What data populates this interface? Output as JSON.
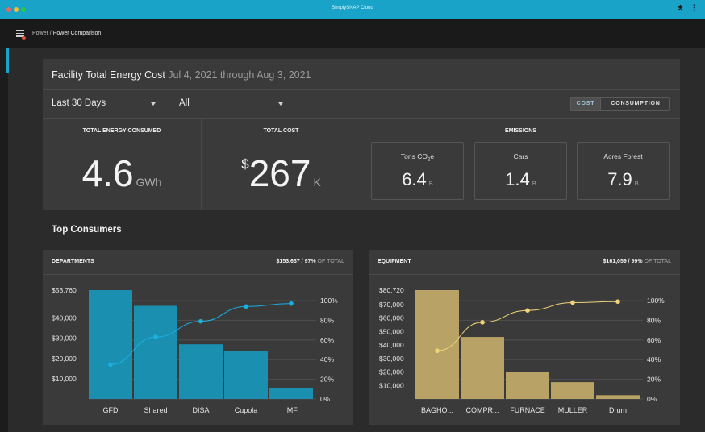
{
  "window": {
    "title": "SimplySNAP Cloud",
    "extension_icon": "puzzle-icon",
    "more_icon": "kebab-menu-icon",
    "traffic_lights": [
      "#ff5f57",
      "#febc2e",
      "#28c840"
    ]
  },
  "appbar": {
    "menu_icon": "hamburger-menu-icon",
    "breadcrumb_parent": "Power",
    "breadcrumb_sep": "/",
    "breadcrumb_current": "Power Comparison"
  },
  "header": {
    "title": "Facility Total Energy Cost",
    "dates": "Jul 4, 2021 through Aug 3, 2021",
    "range_select": "Last 30 Days",
    "filter_select": "All",
    "toggle": {
      "active": "COST",
      "inactive": "CONSUMPTION"
    }
  },
  "kpis": {
    "energy": {
      "label": "TOTAL ENERGY CONSUMED",
      "value": "4.6",
      "unit": "GWh"
    },
    "cost": {
      "label": "TOTAL COST",
      "prefix": "$",
      "value": "267",
      "unit": "K"
    },
    "emissions": {
      "label": "EMISSIONS",
      "items": [
        {
          "label_main": "Tons CO",
          "label_sub": "2",
          "label_tail": "e",
          "value": "6.4",
          "unit": "B"
        },
        {
          "label_main": "Cars",
          "label_sub": "",
          "label_tail": "",
          "value": "1.4",
          "unit": "B"
        },
        {
          "label_main": "Acres Forest",
          "label_sub": "",
          "label_tail": "",
          "value": "7.9",
          "unit": "B"
        }
      ]
    }
  },
  "section_title": "Top Consumers",
  "colors": {
    "accent": "#1aa3c8",
    "departments_bar": "#1a8fb0",
    "departments_line": "#1ab0e0",
    "equipment_bar": "#b9a265",
    "equipment_line": "#f0d478",
    "panel": "#3a3a3a",
    "background": "#2b2b2b"
  },
  "chart_data": [
    {
      "type": "bar",
      "title": "DEPARTMENTS",
      "total": "$153,637",
      "total_pct": "97%",
      "total_suffix": "OF TOTAL",
      "categories": [
        "GFD",
        "Shared",
        "DISA",
        "Cupola",
        "IMF"
      ],
      "values": [
        53760,
        46000,
        27000,
        23500,
        5500
      ],
      "ylim": [
        0,
        53760
      ],
      "yticks": [
        10000,
        20000,
        30000,
        40000,
        53760
      ],
      "ytick_labels": [
        "$10,000",
        "$20,000",
        "$30,000",
        "$40,000",
        "$53,760"
      ],
      "series": [
        {
          "type": "line",
          "axis": "right",
          "values": [
            35,
            63,
            79,
            94,
            97
          ]
        }
      ],
      "y2lim": [
        0,
        100
      ],
      "y2ticks": [
        0,
        20,
        40,
        60,
        80,
        100
      ],
      "y2tick_labels": [
        "0%",
        "20%",
        "40%",
        "60%",
        "80%",
        "100%"
      ],
      "grid": true
    },
    {
      "type": "bar",
      "title": "EQUIPMENT",
      "total": "$161,059",
      "total_pct": "99%",
      "total_suffix": "OF TOTAL",
      "categories": [
        "BAGHO...",
        "COMPR...",
        "FURNACE",
        "MULLER",
        "Drum"
      ],
      "values": [
        80720,
        46000,
        20000,
        12500,
        2800
      ],
      "ylim": [
        0,
        80720
      ],
      "yticks": [
        10000,
        20000,
        30000,
        40000,
        50000,
        60000,
        70000,
        80720
      ],
      "ytick_labels": [
        "$10,000",
        "$20,000",
        "$30,000",
        "$40,000",
        "$50,000",
        "$60,000",
        "$70,000",
        "$80,720"
      ],
      "series": [
        {
          "type": "line",
          "axis": "right",
          "values": [
            49,
            78,
            90,
            98,
            99
          ]
        }
      ],
      "y2lim": [
        0,
        100
      ],
      "y2ticks": [
        0,
        20,
        40,
        60,
        80,
        100
      ],
      "y2tick_labels": [
        "0%",
        "20%",
        "40%",
        "60%",
        "80%",
        "100%"
      ],
      "grid": true
    }
  ]
}
